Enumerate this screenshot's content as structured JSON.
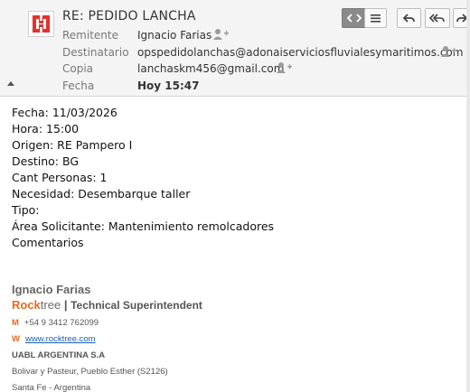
{
  "header": {
    "subject": "RE: PEDIDO LANCHA",
    "fields": {
      "from_label": "Remitente",
      "from_value": "Ignacio Farias",
      "to_label": "Destinatario",
      "to_value": "opspedidolanchas@adonaiserviciosfluvialesymaritimos.com",
      "cc_label": "Copia",
      "cc_value": "lanchaskm456@gmail.com",
      "date_label": "Fecha",
      "date_value": "Hoy 15:47"
    },
    "toolbar": [
      "toggle-html-icon",
      "menu-icon",
      "reply-icon",
      "reply-all-icon",
      "forward-icon"
    ],
    "accent_color": "#e5312c"
  },
  "message": {
    "lines": [
      "Fecha: 11/03/2026",
      "Hora: 15:00",
      "Origen: RE Pampero I",
      "Destino: BG",
      "Cant Personas: 1",
      "Necesidad: Desembarque taller",
      "Tipo:",
      "Área Solicitante: Mantenimiento remolcadores",
      "Comentarios"
    ]
  },
  "signature": {
    "name": "Ignacio Farias",
    "brand_rock": "Rock",
    "brand_tree": "tree",
    "separator": "|",
    "job_title": "Technical Superintendent",
    "mobile_tag": "M",
    "mobile": "+54 9 3412 762099",
    "web_tag": "W",
    "web": "www.rocktree.com",
    "company": "UABL ARGENTINA S.A",
    "address1": "Bolivar y Pasteur, Pueblo Esther (S2126)",
    "address2": "Santa Fe - Argentina",
    "brand_color": "#e56a1e"
  }
}
